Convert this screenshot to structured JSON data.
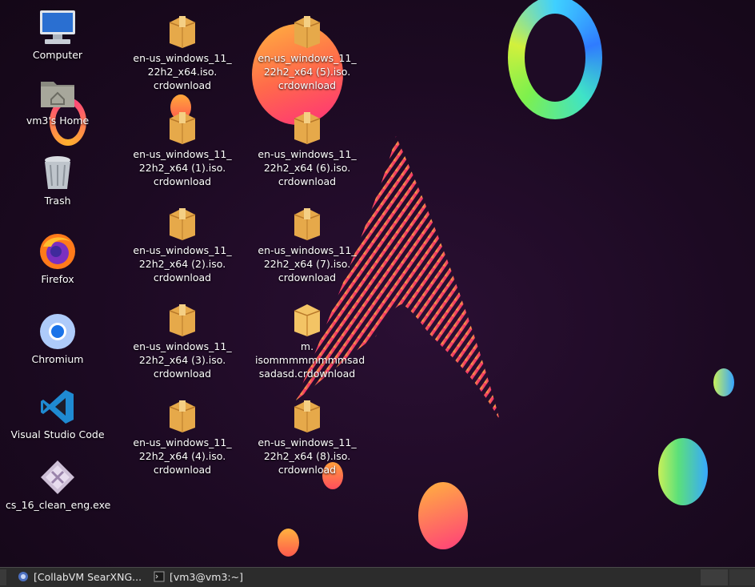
{
  "desktop": {
    "left_icons": [
      {
        "label": "Computer",
        "icon": "computer-icon"
      },
      {
        "label": "vm3's Home",
        "icon": "home-folder-icon"
      },
      {
        "label": "Trash",
        "icon": "trash-icon"
      },
      {
        "label": "Firefox",
        "icon": "firefox-icon"
      },
      {
        "label": "Chromium",
        "icon": "chromium-icon"
      },
      {
        "label": "Visual Studio Code",
        "icon": "vscode-icon"
      },
      {
        "label": "cs_16_clean_eng.exe",
        "icon": "exe-file-icon"
      }
    ],
    "files": [
      {
        "label": "en-us_windows_11_\n22h2_x64.iso.\ncrdownload",
        "icon": "package-icon"
      },
      {
        "label": "en-us_windows_11_\n22h2_x64 (1).iso.\ncrdownload",
        "icon": "package-icon"
      },
      {
        "label": "en-us_windows_11_\n22h2_x64 (2).iso.\ncrdownload",
        "icon": "package-icon"
      },
      {
        "label": "en-us_windows_11_\n22h2_x64 (3).iso.\ncrdownload",
        "icon": "package-icon"
      },
      {
        "label": "en-us_windows_11_\n22h2_x64 (4).iso.\ncrdownload",
        "icon": "package-icon"
      },
      {
        "label": "en-us_windows_11_\n22h2_x64 (5).iso.\ncrdownload",
        "icon": "package-icon"
      },
      {
        "label": "en-us_windows_11_\n22h2_x64 (6).iso.\ncrdownload",
        "icon": "package-icon"
      },
      {
        "label": "en-us_windows_11_\n22h2_x64 (7).iso.\ncrdownload",
        "icon": "package-icon"
      },
      {
        "label": "m.\nisommmmmmmmsad\nsadasd.crdownload",
        "icon": "package-icon"
      },
      {
        "label": "en-us_windows_11_\n22h2_x64 (8).iso.\ncrdownload",
        "icon": "package-icon"
      }
    ]
  },
  "taskbar": {
    "tasks": [
      {
        "label": "[CollabVM SearXNG...",
        "icon": "browser-icon"
      },
      {
        "label": "[vm3@vm3:~]",
        "icon": "terminal-icon"
      }
    ]
  },
  "colors": {
    "background": "#1c0a22",
    "accent_pink": "#ff2f7a",
    "accent_orange": "#ffb23f",
    "taskbar": "#2c2c2c"
  }
}
